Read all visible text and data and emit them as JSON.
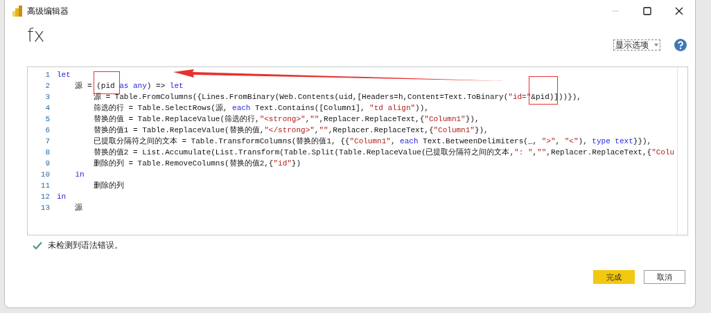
{
  "window": {
    "title": "高级编辑器",
    "controls": [
      {
        "kind": "minimize",
        "disabled": true
      },
      {
        "kind": "maximize",
        "disabled": false
      },
      {
        "kind": "close",
        "disabled": false
      }
    ]
  },
  "formula_label": "fx",
  "display_options": {
    "label": "显示选项"
  },
  "editor": {
    "lines": [
      {
        "number": "1",
        "segments": [
          {
            "text": "let",
            "kind": "keyword"
          }
        ]
      },
      {
        "number": "2",
        "segments": [
          {
            "text": "    源 = (pid ",
            "kind": "plain"
          },
          {
            "text": "as any",
            "kind": "keyword"
          },
          {
            "text": ") => ",
            "kind": "plain"
          },
          {
            "text": "let",
            "kind": "keyword"
          }
        ]
      },
      {
        "number": "3",
        "segments": [
          {
            "text": "        源 = Table.FromColumns({Lines.FromBinary(Web.Contents(uid,[Headers=h,Content=Text.ToBinary(",
            "kind": "plain"
          },
          {
            "text": "\"id=\"",
            "kind": "string"
          },
          {
            "text": "&pid)]))}),",
            "kind": "plain"
          }
        ]
      },
      {
        "number": "4",
        "segments": [
          {
            "text": "        筛选的行 = Table.SelectRows(源, ",
            "kind": "plain"
          },
          {
            "text": "each",
            "kind": "keyword"
          },
          {
            "text": " Text.Contains([Column1], ",
            "kind": "plain"
          },
          {
            "text": "\"td align\"",
            "kind": "string"
          },
          {
            "text": ")),",
            "kind": "plain"
          }
        ]
      },
      {
        "number": "5",
        "segments": [
          {
            "text": "        替换的值 = Table.ReplaceValue(筛选的行,",
            "kind": "plain"
          },
          {
            "text": "\"<strong>\"",
            "kind": "string"
          },
          {
            "text": ",",
            "kind": "plain"
          },
          {
            "text": "\"\"",
            "kind": "string"
          },
          {
            "text": ",Replacer.ReplaceText,{",
            "kind": "plain"
          },
          {
            "text": "\"Column1\"",
            "kind": "string"
          },
          {
            "text": "}),",
            "kind": "plain"
          }
        ]
      },
      {
        "number": "6",
        "segments": [
          {
            "text": "        替换的值1 = Table.ReplaceValue(替换的值,",
            "kind": "plain"
          },
          {
            "text": "\"</strong>\"",
            "kind": "string"
          },
          {
            "text": ",",
            "kind": "plain"
          },
          {
            "text": "\"\"",
            "kind": "string"
          },
          {
            "text": ",Replacer.ReplaceText,{",
            "kind": "plain"
          },
          {
            "text": "\"Column1\"",
            "kind": "string"
          },
          {
            "text": "}),",
            "kind": "plain"
          }
        ]
      },
      {
        "number": "7",
        "segments": [
          {
            "text": "        已提取分隔符之间的文本 = Table.TransformColumns(替换的值1, {{",
            "kind": "plain"
          },
          {
            "text": "\"Column1\"",
            "kind": "string"
          },
          {
            "text": ", ",
            "kind": "plain"
          },
          {
            "text": "each",
            "kind": "keyword"
          },
          {
            "text": " Text.BetweenDelimiters(_, ",
            "kind": "plain"
          },
          {
            "text": "\">\"",
            "kind": "string"
          },
          {
            "text": ", ",
            "kind": "plain"
          },
          {
            "text": "\"<\"",
            "kind": "string"
          },
          {
            "text": "), ",
            "kind": "plain"
          },
          {
            "text": "type text",
            "kind": "keyword"
          },
          {
            "text": "}}),",
            "kind": "plain"
          }
        ]
      },
      {
        "number": "8",
        "segments": [
          {
            "text": "        替换的值2 = List.Accumulate(List.Transform(Table.Split(Table.ReplaceValue(已提取分隔符之间的文本,",
            "kind": "plain"
          },
          {
            "text": "\": \"",
            "kind": "string"
          },
          {
            "text": ",",
            "kind": "plain"
          },
          {
            "text": "\"\"",
            "kind": "string"
          },
          {
            "text": ",Replacer.ReplaceText,{",
            "kind": "plain"
          },
          {
            "text": "\"Colu",
            "kind": "string"
          }
        ]
      },
      {
        "number": "9",
        "segments": [
          {
            "text": "        删除的列 = Table.RemoveColumns(替换的值2,{",
            "kind": "plain"
          },
          {
            "text": "\"id\"",
            "kind": "string"
          },
          {
            "text": "})",
            "kind": "plain"
          }
        ]
      },
      {
        "number": "10",
        "segments": [
          {
            "text": "    in",
            "kind": "keyword"
          }
        ]
      },
      {
        "number": "11",
        "segments": [
          {
            "text": "        删除的列",
            "kind": "plain"
          }
        ]
      },
      {
        "number": "12",
        "segments": [
          {
            "text": "in",
            "kind": "keyword"
          }
        ]
      },
      {
        "number": "13",
        "segments": [
          {
            "text": "    源",
            "kind": "plain"
          }
        ]
      }
    ]
  },
  "status": {
    "ok": true,
    "message": "未检测到语法错误。"
  },
  "buttons": [
    {
      "label": "完成",
      "kind": "primary"
    },
    {
      "label": "取消",
      "kind": "secondary"
    }
  ]
}
